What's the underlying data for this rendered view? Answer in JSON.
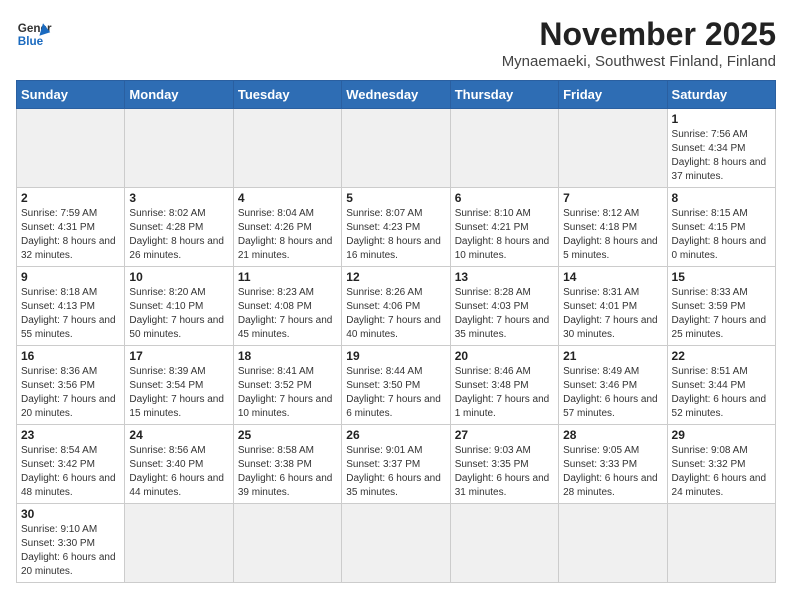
{
  "header": {
    "logo_general": "General",
    "logo_blue": "Blue",
    "month": "November 2025",
    "location": "Mynaemaeki, Southwest Finland, Finland"
  },
  "days_of_week": [
    "Sunday",
    "Monday",
    "Tuesday",
    "Wednesday",
    "Thursday",
    "Friday",
    "Saturday"
  ],
  "weeks": [
    [
      {
        "day": "",
        "info": ""
      },
      {
        "day": "",
        "info": ""
      },
      {
        "day": "",
        "info": ""
      },
      {
        "day": "",
        "info": ""
      },
      {
        "day": "",
        "info": ""
      },
      {
        "day": "",
        "info": ""
      },
      {
        "day": "1",
        "info": "Sunrise: 7:56 AM\nSunset: 4:34 PM\nDaylight: 8 hours and 37 minutes."
      }
    ],
    [
      {
        "day": "2",
        "info": "Sunrise: 7:59 AM\nSunset: 4:31 PM\nDaylight: 8 hours and 32 minutes."
      },
      {
        "day": "3",
        "info": "Sunrise: 8:02 AM\nSunset: 4:28 PM\nDaylight: 8 hours and 26 minutes."
      },
      {
        "day": "4",
        "info": "Sunrise: 8:04 AM\nSunset: 4:26 PM\nDaylight: 8 hours and 21 minutes."
      },
      {
        "day": "5",
        "info": "Sunrise: 8:07 AM\nSunset: 4:23 PM\nDaylight: 8 hours and 16 minutes."
      },
      {
        "day": "6",
        "info": "Sunrise: 8:10 AM\nSunset: 4:21 PM\nDaylight: 8 hours and 10 minutes."
      },
      {
        "day": "7",
        "info": "Sunrise: 8:12 AM\nSunset: 4:18 PM\nDaylight: 8 hours and 5 minutes."
      },
      {
        "day": "8",
        "info": "Sunrise: 8:15 AM\nSunset: 4:15 PM\nDaylight: 8 hours and 0 minutes."
      }
    ],
    [
      {
        "day": "9",
        "info": "Sunrise: 8:18 AM\nSunset: 4:13 PM\nDaylight: 7 hours and 55 minutes."
      },
      {
        "day": "10",
        "info": "Sunrise: 8:20 AM\nSunset: 4:10 PM\nDaylight: 7 hours and 50 minutes."
      },
      {
        "day": "11",
        "info": "Sunrise: 8:23 AM\nSunset: 4:08 PM\nDaylight: 7 hours and 45 minutes."
      },
      {
        "day": "12",
        "info": "Sunrise: 8:26 AM\nSunset: 4:06 PM\nDaylight: 7 hours and 40 minutes."
      },
      {
        "day": "13",
        "info": "Sunrise: 8:28 AM\nSunset: 4:03 PM\nDaylight: 7 hours and 35 minutes."
      },
      {
        "day": "14",
        "info": "Sunrise: 8:31 AM\nSunset: 4:01 PM\nDaylight: 7 hours and 30 minutes."
      },
      {
        "day": "15",
        "info": "Sunrise: 8:33 AM\nSunset: 3:59 PM\nDaylight: 7 hours and 25 minutes."
      }
    ],
    [
      {
        "day": "16",
        "info": "Sunrise: 8:36 AM\nSunset: 3:56 PM\nDaylight: 7 hours and 20 minutes."
      },
      {
        "day": "17",
        "info": "Sunrise: 8:39 AM\nSunset: 3:54 PM\nDaylight: 7 hours and 15 minutes."
      },
      {
        "day": "18",
        "info": "Sunrise: 8:41 AM\nSunset: 3:52 PM\nDaylight: 7 hours and 10 minutes."
      },
      {
        "day": "19",
        "info": "Sunrise: 8:44 AM\nSunset: 3:50 PM\nDaylight: 7 hours and 6 minutes."
      },
      {
        "day": "20",
        "info": "Sunrise: 8:46 AM\nSunset: 3:48 PM\nDaylight: 7 hours and 1 minute."
      },
      {
        "day": "21",
        "info": "Sunrise: 8:49 AM\nSunset: 3:46 PM\nDaylight: 6 hours and 57 minutes."
      },
      {
        "day": "22",
        "info": "Sunrise: 8:51 AM\nSunset: 3:44 PM\nDaylight: 6 hours and 52 minutes."
      }
    ],
    [
      {
        "day": "23",
        "info": "Sunrise: 8:54 AM\nSunset: 3:42 PM\nDaylight: 6 hours and 48 minutes."
      },
      {
        "day": "24",
        "info": "Sunrise: 8:56 AM\nSunset: 3:40 PM\nDaylight: 6 hours and 44 minutes."
      },
      {
        "day": "25",
        "info": "Sunrise: 8:58 AM\nSunset: 3:38 PM\nDaylight: 6 hours and 39 minutes."
      },
      {
        "day": "26",
        "info": "Sunrise: 9:01 AM\nSunset: 3:37 PM\nDaylight: 6 hours and 35 minutes."
      },
      {
        "day": "27",
        "info": "Sunrise: 9:03 AM\nSunset: 3:35 PM\nDaylight: 6 hours and 31 minutes."
      },
      {
        "day": "28",
        "info": "Sunrise: 9:05 AM\nSunset: 3:33 PM\nDaylight: 6 hours and 28 minutes."
      },
      {
        "day": "29",
        "info": "Sunrise: 9:08 AM\nSunset: 3:32 PM\nDaylight: 6 hours and 24 minutes."
      }
    ],
    [
      {
        "day": "30",
        "info": "Sunrise: 9:10 AM\nSunset: 3:30 PM\nDaylight: 6 hours and 20 minutes."
      },
      {
        "day": "",
        "info": ""
      },
      {
        "day": "",
        "info": ""
      },
      {
        "day": "",
        "info": ""
      },
      {
        "day": "",
        "info": ""
      },
      {
        "day": "",
        "info": ""
      },
      {
        "day": "",
        "info": ""
      }
    ]
  ]
}
